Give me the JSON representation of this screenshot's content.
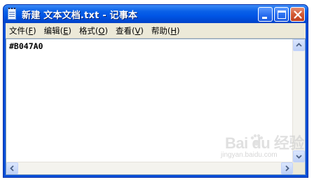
{
  "window": {
    "title": "新建 文本文档.txt - 记事本",
    "buttons": {
      "minimize": "minimize",
      "maximize": "maximize",
      "close": "close"
    }
  },
  "menu": [
    {
      "label": "文件",
      "mnemonic": "F"
    },
    {
      "label": "编辑",
      "mnemonic": "E"
    },
    {
      "label": "格式",
      "mnemonic": "O"
    },
    {
      "label": "查看",
      "mnemonic": "V"
    },
    {
      "label": "帮助",
      "mnemonic": "H"
    }
  ],
  "editor": {
    "content": "#B047A0"
  },
  "watermark": {
    "brand": "Bai du 经验",
    "url": "jingyan.baidu.com"
  },
  "icons": {
    "app": "notepad-icon",
    "minimize": "minimize-icon",
    "maximize": "maximize-icon",
    "close": "close-icon"
  },
  "colors": {
    "titlebar": "#0055e5",
    "menubar": "#ece9d8",
    "close_button": "#d35a35"
  }
}
